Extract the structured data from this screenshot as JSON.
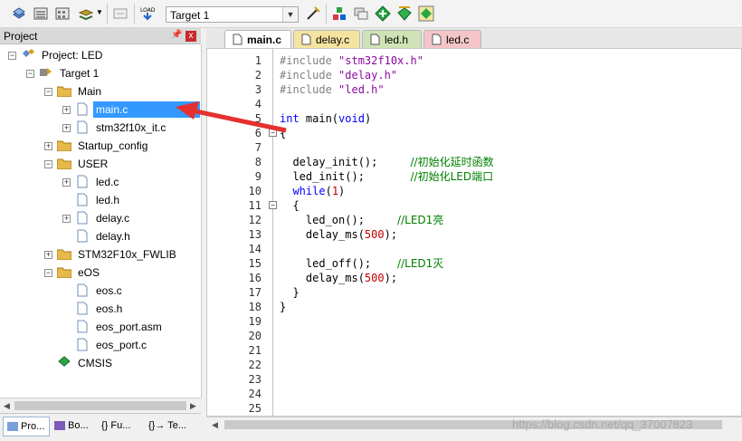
{
  "toolbar": {
    "target": "Target 1",
    "icons": [
      "build-icon",
      "rebuild-icon",
      "batch-build-icon",
      "stack-icon",
      "dropdown-icon",
      "translate-icon",
      "load-icon",
      "target-options-icon",
      "components-icon",
      "manage-icon",
      "pack-installer-icon",
      "select-device-icon",
      "packs-icon"
    ]
  },
  "project_pane": {
    "title": "Project",
    "pin": "☐",
    "close": "x",
    "tree": [
      {
        "label": "Project: LED"
      },
      {
        "label": "Target 1"
      },
      {
        "label": "Main"
      },
      {
        "label": "main.c"
      },
      {
        "label": "stm32f10x_it.c"
      },
      {
        "label": "Startup_config"
      },
      {
        "label": "USER"
      },
      {
        "label": "led.c"
      },
      {
        "label": "led.h"
      },
      {
        "label": "delay.c"
      },
      {
        "label": "delay.h"
      },
      {
        "label": "STM32F10x_FWLIB"
      },
      {
        "label": "eOS"
      },
      {
        "label": "eos.c"
      },
      {
        "label": "eos.h"
      },
      {
        "label": "eos_port.asm"
      },
      {
        "label": "eos_port.c"
      },
      {
        "label": "CMSIS"
      }
    ],
    "bottom_tabs": [
      "Pro...",
      "Bo...",
      "{} Fu...",
      "{}→ Te..."
    ]
  },
  "editor": {
    "tabs": [
      {
        "label": "main.c",
        "color": "#d6e6f7"
      },
      {
        "label": "delay.c",
        "color": "#f5e3a0"
      },
      {
        "label": "led.h",
        "color": "#cfe3b6"
      },
      {
        "label": "led.c",
        "color": "#f3c5c9"
      }
    ],
    "line_numbers": [
      "1",
      "2",
      "3",
      "4",
      "5",
      "6",
      "7",
      "8",
      "9",
      "10",
      "11",
      "12",
      "13",
      "14",
      "15",
      "16",
      "17",
      "18",
      "19",
      "20",
      "21",
      "22",
      "23",
      "24",
      "25"
    ],
    "lines": {
      "l1_pp": "#include ",
      "l1_s": "\"stm32f10x.h\"",
      "l2_pp": "#include ",
      "l2_s": "\"delay.h\"",
      "l3_pp": "#include ",
      "l3_s": "\"led.h\"",
      "l5_kw1": "int",
      "l5_a": " main(",
      "l5_kw2": "void",
      "l5_b": ")",
      "l6": "{",
      "l8_code": "  delay_init();     ",
      "l8_c": "//初始化延时函数",
      "l9_code": "  led_init();       ",
      "l9_c": "//初始化LED端口",
      "l10_kw": "while",
      "l10_a": "(",
      "l10_n": "1",
      "l10_b": ")",
      "l11": "  {",
      "l12_code": "    led_on();     ",
      "l12_c": "//LED1亮",
      "l13_a": "    delay_ms(",
      "l13_n": "500",
      "l13_b": ");",
      "l15_code": "    led_off();    ",
      "l15_c": "//LED1灭",
      "l16_a": "    delay_ms(",
      "l16_n": "500",
      "l16_b": ");",
      "l17": "  }",
      "l18": "}"
    }
  },
  "watermark": "https://blog.csdn.net/qq_37007823"
}
